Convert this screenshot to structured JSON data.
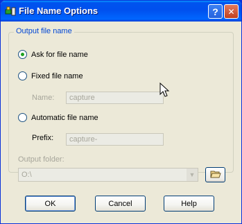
{
  "window": {
    "title": "File Name Options"
  },
  "titlebar": {
    "help_label": "?",
    "close_label": "✕"
  },
  "group": {
    "title": "Output file name"
  },
  "options": {
    "ask": {
      "label": "Ask for file name",
      "selected": true
    },
    "fixed": {
      "label": "Fixed file name",
      "selected": false
    },
    "automatic": {
      "label": "Automatic file name",
      "selected": false
    }
  },
  "fields": {
    "name": {
      "label": "Name:",
      "value": "capture"
    },
    "prefix": {
      "label": "Prefix:",
      "value": "capture-"
    }
  },
  "output_folder": {
    "label": "Output folder:",
    "value": "O:\\"
  },
  "buttons": {
    "ok": "OK",
    "cancel": "Cancel",
    "help": "Help"
  },
  "icons": {
    "app": "app-icon",
    "browse": "folder-open-icon",
    "dropdown": "chevron-down-icon",
    "cursor": "mouse-pointer-icon"
  }
}
